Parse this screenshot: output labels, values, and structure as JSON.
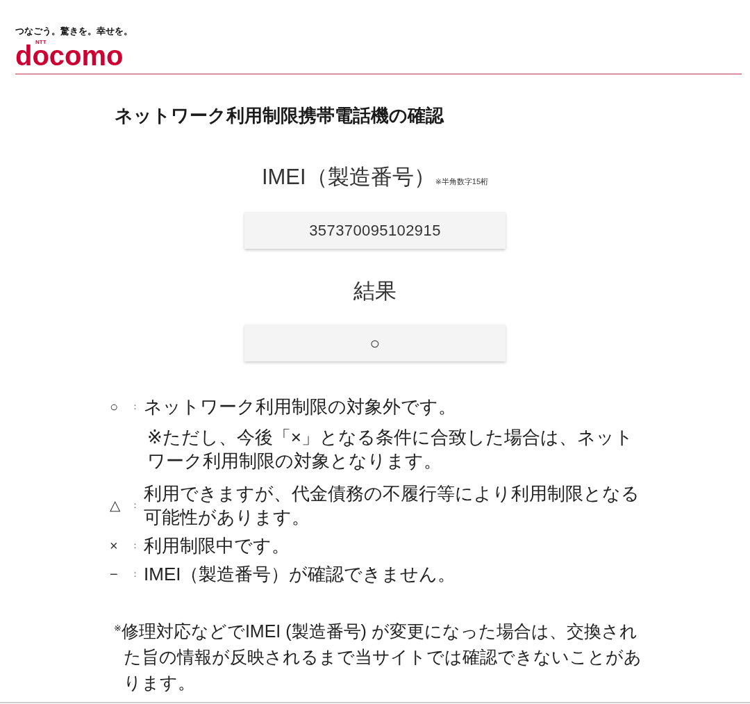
{
  "header": {
    "tagline": "つなごう。驚きを。幸せを。",
    "logo": {
      "mark": "NTT",
      "brand": "docomo"
    }
  },
  "title": "ネットワーク利用制限携帯電話機の確認",
  "imei": {
    "label": "IMEI（製造番号）",
    "note": "※半角数字15桁",
    "value": "357370095102915"
  },
  "result": {
    "label": "結果",
    "value": "○"
  },
  "legend": [
    {
      "symbol": "○",
      "separator": "：",
      "text": "ネットワーク利用制限の対象外です。",
      "note": "※ただし、今後「×」となる条件に合致した場合は、ネットワーク利用制限の対象となります。"
    },
    {
      "symbol": "△",
      "separator": "：",
      "text": "利用できますが、代金債務の不履行等により利用制限となる可能性があります。"
    },
    {
      "symbol": "×",
      "separator": "：",
      "text": "利用制限中です。"
    },
    {
      "symbol": "−",
      "separator": "：",
      "text": "IMEI（製造番号）が確認できません。"
    }
  ],
  "footnote": "$^{※}$修理対応などでIMEI (製造番号) が変更になった場合は、交換された旨の情報が反映されるまで当サイトでは確認できないことがあります。"
}
